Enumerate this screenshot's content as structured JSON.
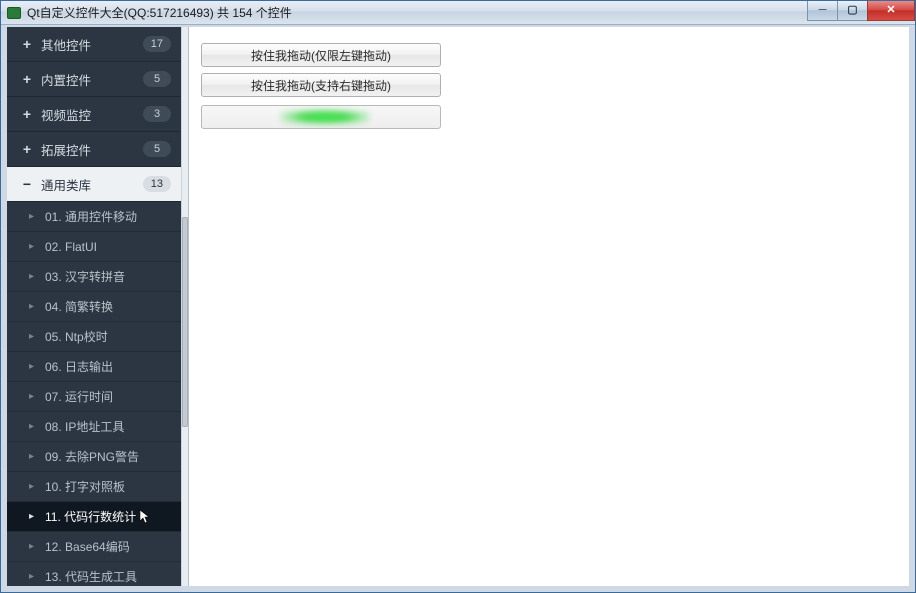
{
  "window": {
    "title": "Qt自定义控件大全(QQ:517216493) 共 154 个控件"
  },
  "sidebar": {
    "categories": [
      {
        "expand": "+",
        "label": "其他控件",
        "count": "17",
        "expanded": false
      },
      {
        "expand": "+",
        "label": "内置控件",
        "count": "5",
        "expanded": false
      },
      {
        "expand": "+",
        "label": "视频监控",
        "count": "3",
        "expanded": false
      },
      {
        "expand": "+",
        "label": "拓展控件",
        "count": "5",
        "expanded": false
      },
      {
        "expand": "−",
        "label": "通用类库",
        "count": "13",
        "expanded": true
      }
    ],
    "items": [
      {
        "label": "01. 通用控件移动",
        "selected": false
      },
      {
        "label": "02. FlatUI",
        "selected": false
      },
      {
        "label": "03. 汉字转拼音",
        "selected": false
      },
      {
        "label": "04. 简繁转换",
        "selected": false
      },
      {
        "label": "05. Ntp校时",
        "selected": false
      },
      {
        "label": "06. 日志输出",
        "selected": false
      },
      {
        "label": "07. 运行时间",
        "selected": false
      },
      {
        "label": "08. IP地址工具",
        "selected": false
      },
      {
        "label": "09. 去除PNG警告",
        "selected": false
      },
      {
        "label": "10. 打字对照板",
        "selected": false
      },
      {
        "label": "11. 代码行数统计",
        "selected": true
      },
      {
        "label": "12. Base64编码",
        "selected": false
      },
      {
        "label": "13. 代码生成工具",
        "selected": false
      }
    ]
  },
  "main": {
    "button1": "按住我拖动(仅限左键拖动)",
    "button2": "按住我拖动(支持右键拖动)"
  }
}
